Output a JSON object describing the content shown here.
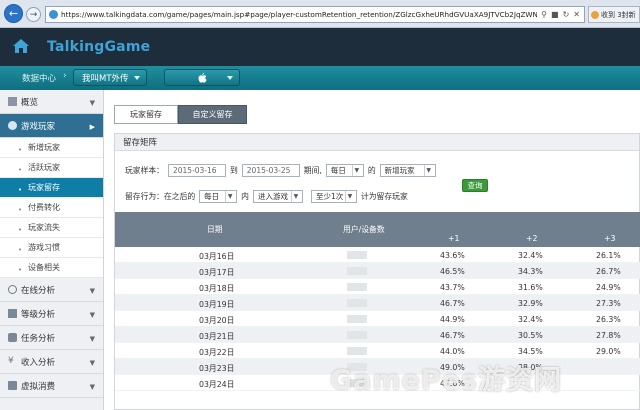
{
  "browser": {
    "url": "https://www.talkingdata.com/game/pages/main.jsp#page/player-customRetention_retention/ZGlzcGxheURhdGVUaXA9JTVCb2JqZWN0JTIwT2Jqz",
    "ext_tab_label": "收到 3封新"
  },
  "header": {
    "brand": "TalkingGame"
  },
  "subbar": {
    "breadcrumb": "数据中心",
    "game_selector": "我叫MT外传",
    "platform_icon": "apple-icon"
  },
  "sidebar": {
    "items": [
      {
        "label": "概览",
        "icon": "overview-icon"
      },
      {
        "label": "游戏玩家",
        "icon": "user-icon"
      },
      {
        "label": "在线分析",
        "icon": "clock-icon"
      },
      {
        "label": "等级分析",
        "icon": "level-icon"
      },
      {
        "label": "任务分析",
        "icon": "task-icon"
      },
      {
        "label": "收入分析",
        "icon": "yen-icon"
      },
      {
        "label": "虚拟消费",
        "icon": "cart-icon"
      }
    ],
    "sub_items": [
      {
        "label": "新增玩家"
      },
      {
        "label": "活跃玩家"
      },
      {
        "label": "玩家留存"
      },
      {
        "label": "付费转化"
      },
      {
        "label": "玩家流失"
      },
      {
        "label": "游戏习惯"
      },
      {
        "label": "设备相关"
      }
    ]
  },
  "tabs": [
    "玩家留存",
    "自定义留存"
  ],
  "panel": {
    "title": "留存矩阵",
    "filters": {
      "sample_label": "玩家样本：",
      "date_from": "2015-03-16",
      "to_label": "到",
      "date_to": "2015-03-25",
      "period_label": "期间,",
      "period_value": "每日",
      "of_label": "的",
      "player_type": "新增玩家",
      "behavior_label": "留存行为：在之后的",
      "behavior_period": "每日",
      "within_label": "内",
      "action": "进入游戏",
      "frequency": "至少1次",
      "count_as": "计为留存玩家",
      "query_button": "查询"
    }
  },
  "table": {
    "headers": {
      "date": "日期",
      "users": "用户/设备数",
      "d1": "+1",
      "d2": "+2",
      "d3": "+3"
    },
    "rows": [
      {
        "date": "03月16日",
        "d1": "43.6%",
        "d2": "32.4%",
        "d3": "26.1%"
      },
      {
        "date": "03月17日",
        "d1": "46.5%",
        "d2": "34.3%",
        "d3": "26.7%"
      },
      {
        "date": "03月18日",
        "d1": "43.7%",
        "d2": "31.6%",
        "d3": "24.9%"
      },
      {
        "date": "03月19日",
        "d1": "46.7%",
        "d2": "32.9%",
        "d3": "27.3%"
      },
      {
        "date": "03月20日",
        "d1": "44.9%",
        "d2": "32.4%",
        "d3": "26.3%"
      },
      {
        "date": "03月21日",
        "d1": "46.7%",
        "d2": "30.5%",
        "d3": "27.8%"
      },
      {
        "date": "03月22日",
        "d1": "44.0%",
        "d2": "34.5%",
        "d3": "29.0%"
      },
      {
        "date": "03月23日",
        "d1": "49.0%",
        "d2": "38.0%",
        "d3": ""
      },
      {
        "date": "03月24日",
        "d1": "47.6%",
        "d2": "",
        "d3": ""
      }
    ]
  },
  "watermark": "GamePes游资网"
}
